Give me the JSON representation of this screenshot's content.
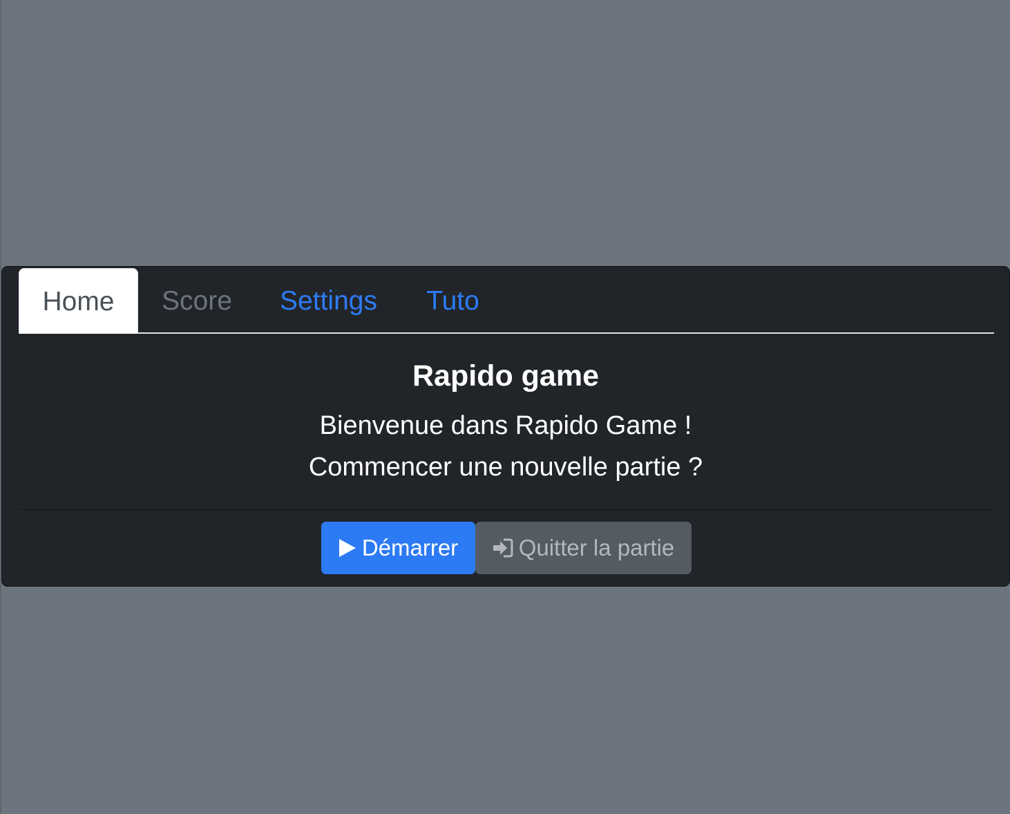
{
  "tabs": [
    {
      "label": "Home",
      "state": "active"
    },
    {
      "label": "Score",
      "state": "disabled"
    },
    {
      "label": "Settings",
      "state": "link"
    },
    {
      "label": "Tuto",
      "state": "link"
    }
  ],
  "main": {
    "title": "Rapido game",
    "welcome_line": "Bienvenue dans Rapido Game !",
    "question_line": "Commencer une nouvelle partie ?"
  },
  "actions": {
    "start": {
      "label": "Démarrer",
      "icon": "play-icon"
    },
    "quit": {
      "label": "Quitter la partie",
      "icon": "sign-in-icon",
      "state": "disabled"
    }
  },
  "colors": {
    "background": "#6c757d",
    "card": "#212529",
    "accent": "#2d7bf4",
    "secondary_button": "#555b62"
  }
}
